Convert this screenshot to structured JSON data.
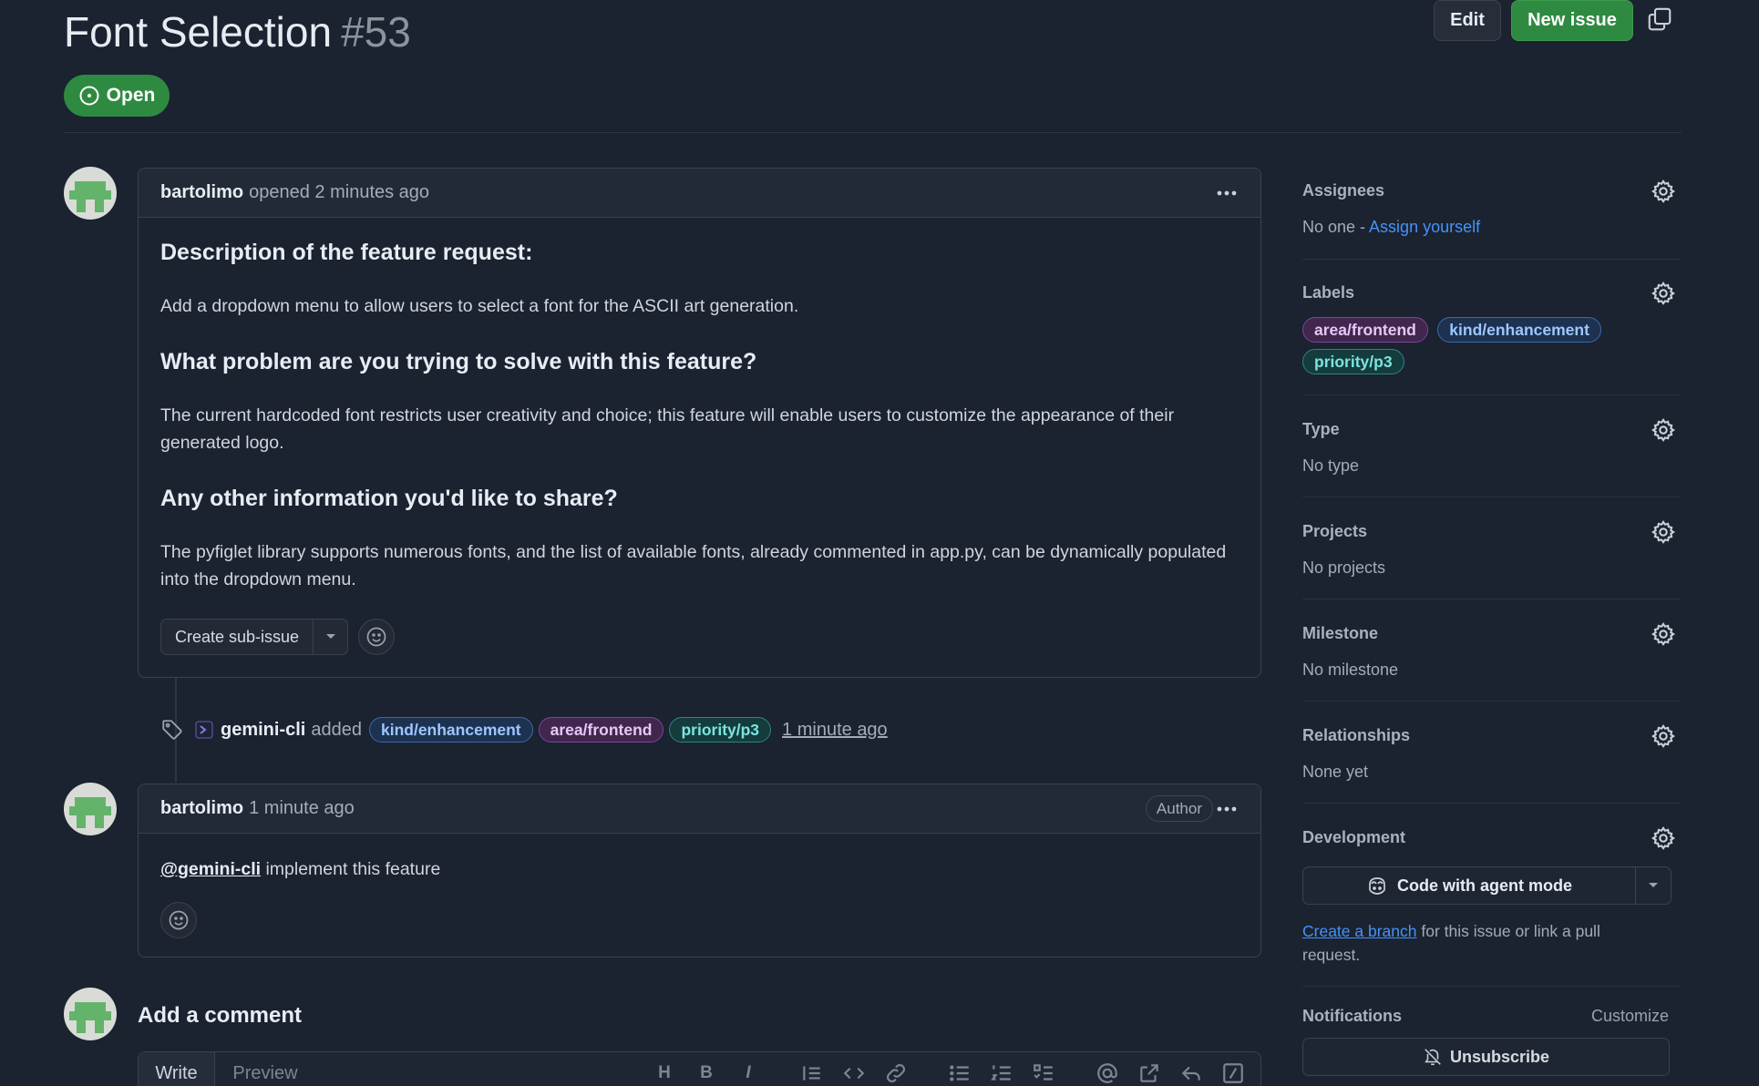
{
  "issue": {
    "title": "Font Selection",
    "number": "#53",
    "state": "Open",
    "edit_label": "Edit",
    "new_issue_label": "New issue"
  },
  "opening_comment": {
    "author": "bartolimo",
    "meta": "opened 2 minutes ago",
    "heading1": "Description of the feature request:",
    "para1": "Add a dropdown menu to allow users to select a font for the ASCII art generation.",
    "heading2": "What problem are you trying to solve with this feature?",
    "para2": "The current hardcoded font restricts user creativity and choice; this feature will enable users to customize the appearance of their generated logo.",
    "heading3": "Any other information you'd like to share?",
    "para3": "The pyfiglet library supports numerous fonts, and the list of available fonts, already commented in app.py, can be dynamically populated into the dropdown menu.",
    "sub_issue_label": "Create sub-issue"
  },
  "label_event": {
    "actor": "gemini-cli",
    "action": "added",
    "labels": [
      "kind/enhancement",
      "area/frontend",
      "priority/p3"
    ],
    "time": "1 minute ago"
  },
  "second_comment": {
    "author": "bartolimo",
    "time": "1 minute ago",
    "role": "Author",
    "mention": "@gemini-cli",
    "text": " implement this feature"
  },
  "add_comment": {
    "title": "Add a comment",
    "tab_write": "Write",
    "tab_preview": "Preview",
    "tool_heading": "H",
    "tool_bold": "B",
    "tool_italic": "I"
  },
  "sidebar": {
    "assignees": {
      "title": "Assignees",
      "none": "No one - ",
      "assign_link": "Assign yourself"
    },
    "labels": {
      "title": "Labels",
      "items": [
        "area/frontend",
        "kind/enhancement",
        "priority/p3"
      ]
    },
    "type": {
      "title": "Type",
      "value": "No type"
    },
    "projects": {
      "title": "Projects",
      "value": "No projects"
    },
    "milestone": {
      "title": "Milestone",
      "value": "No milestone"
    },
    "relationships": {
      "title": "Relationships",
      "value": "None yet"
    },
    "development": {
      "title": "Development",
      "agent_button": "Code with agent mode",
      "branch_link": "Create a branch",
      "branch_text_1": " for this issue or link a pull",
      "branch_text_2": "request."
    },
    "notifications": {
      "title": "Notifications",
      "customize": "Customize",
      "unsubscribe": "Unsubscribe"
    }
  },
  "colors": {
    "background": "#1b2230",
    "open_green": "#2f8a41",
    "link_blue": "#4493f8",
    "label_purple": "#7a46a0",
    "label_blue": "#3b6ba8",
    "label_teal": "#2b8487"
  },
  "icons": [
    "copy-icon",
    "issue-opened-icon",
    "kebab-icon",
    "tag-icon",
    "bot-icon",
    "smiley-icon",
    "gear-icon",
    "copilot-icon",
    "bell-slash-icon",
    "chevron-down-icon"
  ]
}
